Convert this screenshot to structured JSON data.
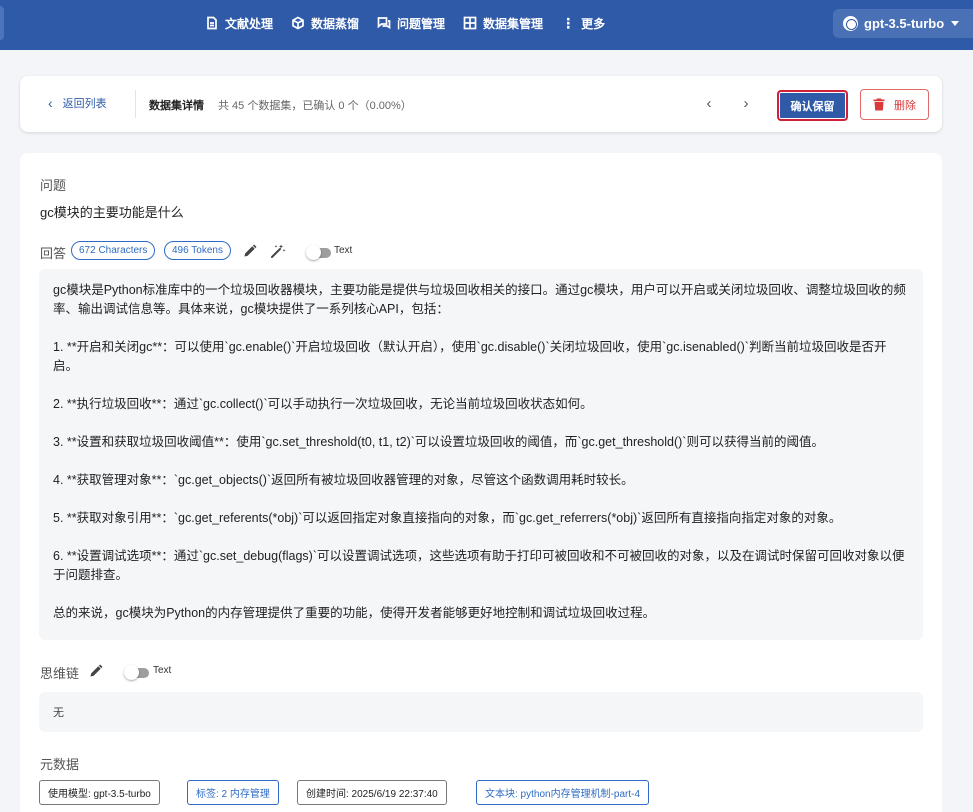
{
  "nav": {
    "items": [
      {
        "label": "文献处理",
        "icon": "document-icon"
      },
      {
        "label": "数据蒸馏",
        "icon": "cube-icon"
      },
      {
        "label": "问题管理",
        "icon": "chat-icon"
      },
      {
        "label": "数据集管理",
        "icon": "grid-icon"
      },
      {
        "label": "更多",
        "icon": "more-vertical-icon"
      }
    ],
    "model": "gpt-3.5-turbo"
  },
  "header": {
    "back_label": "返回列表",
    "title": "数据集详情",
    "subtitle": "共 45 个数据集，已确认 0 个（0.00%）",
    "confirm_label": "确认保留",
    "delete_label": "删除"
  },
  "question": {
    "label": "问题",
    "text": "gc模块的主要功能是什么"
  },
  "answer": {
    "label": "回答",
    "characters": "672 Characters",
    "tokens": "496 Tokens",
    "toggle_label": "Text",
    "paragraphs": [
      "gc模块是Python标准库中的一个垃圾回收器模块，主要功能是提供与垃圾回收相关的接口。通过gc模块，用户可以开启或关闭垃圾回收、调整垃圾回收的频率、输出调试信息等。具体来说，gc模块提供了一系列核心API，包括：",
      "1. **开启和关闭gc**：可以使用`gc.enable()`开启垃圾回收（默认开启），使用`gc.disable()`关闭垃圾回收，使用`gc.isenabled()`判断当前垃圾回收是否开启。",
      "2. **执行垃圾回收**：通过`gc.collect()`可以手动执行一次垃圾回收，无论当前垃圾回收状态如何。",
      "3. **设置和获取垃圾回收阈值**：使用`gc.set_threshold(t0, t1, t2)`可以设置垃圾回收的阈值，而`gc.get_threshold()`则可以获得当前的阈值。",
      "4. **获取管理对象**：`gc.get_objects()`返回所有被垃圾回收器管理的对象，尽管这个函数调用耗时较长。",
      "5. **获取对象引用**：`gc.get_referents(*obj)`可以返回指定对象直接指向的对象，而`gc.get_referrers(*obj)`返回所有直接指向指定对象的对象。",
      "6. **设置调试选项**：通过`gc.set_debug(flags)`可以设置调试选项，这些选项有助于打印可被回收和不可被回收的对象，以及在调试时保留可回收对象以便于问题排查。",
      "总的来说，gc模块为Python的内存管理提供了重要的功能，使得开发者能够更好地控制和调试垃圾回收过程。"
    ]
  },
  "cot": {
    "label": "思维链",
    "toggle_label": "Text",
    "text": "无"
  },
  "metadata": {
    "label": "元数据",
    "model": "使用模型: gpt-3.5-turbo",
    "tags": "标签: 2 内存管理",
    "created": "创建时间: 2025/6/19 22:37:40",
    "chunk": "文本块: python内存管理机制-part-4"
  },
  "colors": {
    "primary": "#2f5aa8",
    "danger": "#d93a3a",
    "chip_blue": "#2f6bc4"
  }
}
